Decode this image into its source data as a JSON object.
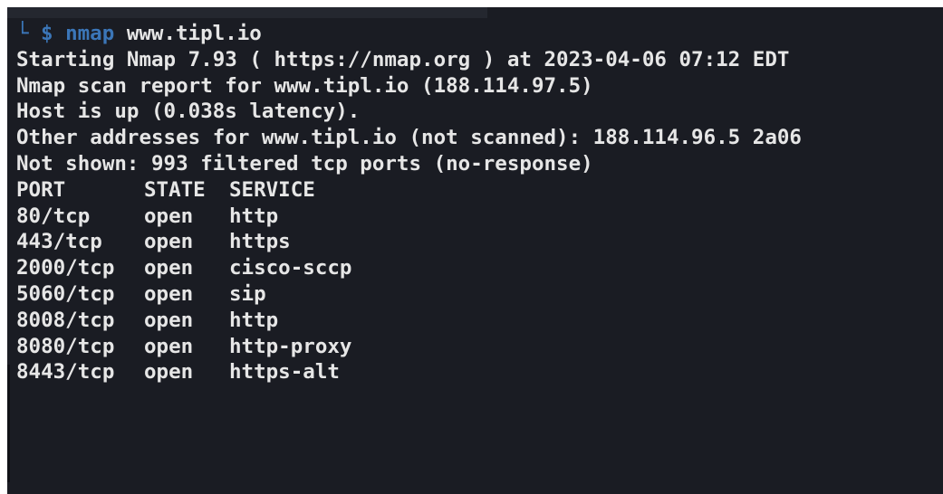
{
  "terminal": {
    "prompt": {
      "corner": "└",
      "symbol": "$",
      "command": "nmap",
      "argument": "www.tipl.io"
    },
    "output": [
      "Starting Nmap 7.93 ( https://nmap.org ) at 2023-04-06 07:12 EDT",
      "Nmap scan report for www.tipl.io (188.114.97.5)",
      "Host is up (0.038s latency).",
      "Other addresses for www.tipl.io (not scanned): 188.114.96.5 2a06",
      "Not shown: 993 filtered tcp ports (no-response)"
    ],
    "table_header": {
      "port": "PORT",
      "state": "STATE",
      "service": "SERVICE"
    },
    "ports": [
      {
        "port": "80/tcp",
        "state": "open",
        "service": "http"
      },
      {
        "port": "443/tcp",
        "state": "open",
        "service": "https"
      },
      {
        "port": "2000/tcp",
        "state": "open",
        "service": "cisco-sccp"
      },
      {
        "port": "5060/tcp",
        "state": "open",
        "service": "sip"
      },
      {
        "port": "8008/tcp",
        "state": "open",
        "service": "http"
      },
      {
        "port": "8080/tcp",
        "state": "open",
        "service": "http-proxy"
      },
      {
        "port": "8443/tcp",
        "state": "open",
        "service": "https-alt"
      }
    ]
  }
}
